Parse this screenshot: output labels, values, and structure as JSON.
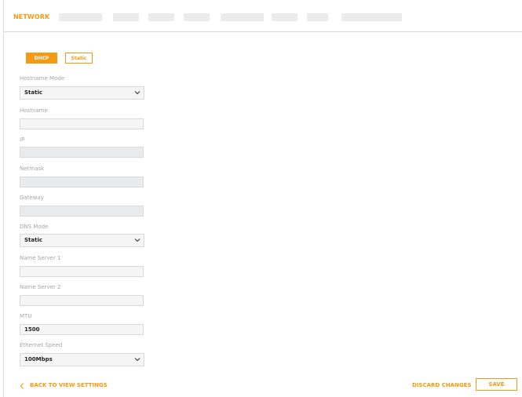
{
  "tabs": {
    "active_label": "NETWORK",
    "placeholder_count": 9
  },
  "mode": {
    "dhcp_label": "DHCP",
    "static_label": "Static",
    "selected": "DHCP"
  },
  "fields": {
    "hostname_mode": {
      "label": "Hostname Mode",
      "value": "Static"
    },
    "hostname": {
      "label": "Hostname",
      "value": ""
    },
    "ip": {
      "label": "IP",
      "value": ""
    },
    "netmask": {
      "label": "Netmask",
      "value": ""
    },
    "gateway": {
      "label": "Gateway",
      "value": ""
    },
    "dns_mode": {
      "label": "DNS Mode",
      "value": "Static"
    },
    "name_server_1": {
      "label": "Name Server 1",
      "value": ""
    },
    "name_server_2": {
      "label": "Name Server 2",
      "value": ""
    },
    "mtu": {
      "label": "MTU",
      "value": "1500"
    },
    "ethernet_speed": {
      "label": "Ethernet Speed",
      "value": "100Mbps"
    }
  },
  "footer": {
    "back_label": "BACK TO VIEW SETTINGS",
    "back_icon": "chevron-left-icon",
    "discard_label": "DISCARD CHANGES",
    "save_label": "SAVE"
  },
  "colors": {
    "accent": "#f59a12",
    "label_grey": "#a6a6a6",
    "input_bg": "#f5f5f5",
    "disabled_bg": "#e9ebed"
  }
}
